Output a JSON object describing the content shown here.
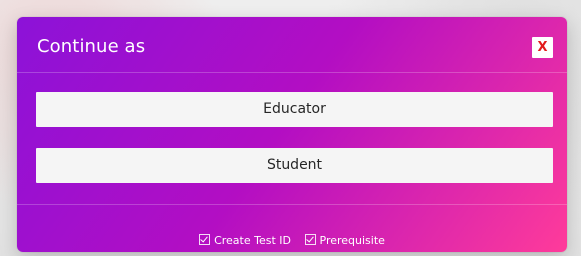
{
  "modal": {
    "title": "Continue as",
    "close_label": "X",
    "buttons": [
      {
        "label": "Educator"
      },
      {
        "label": "Student"
      }
    ],
    "options": [
      {
        "label": "Create Test ID",
        "checked": true
      },
      {
        "label": "Prerequisite",
        "checked": true
      }
    ]
  },
  "colors": {
    "gradient_start": "#8c12d8",
    "gradient_mid": "#b30ec3",
    "gradient_end": "#ff3b9a",
    "close_text": "#e21b1b"
  }
}
